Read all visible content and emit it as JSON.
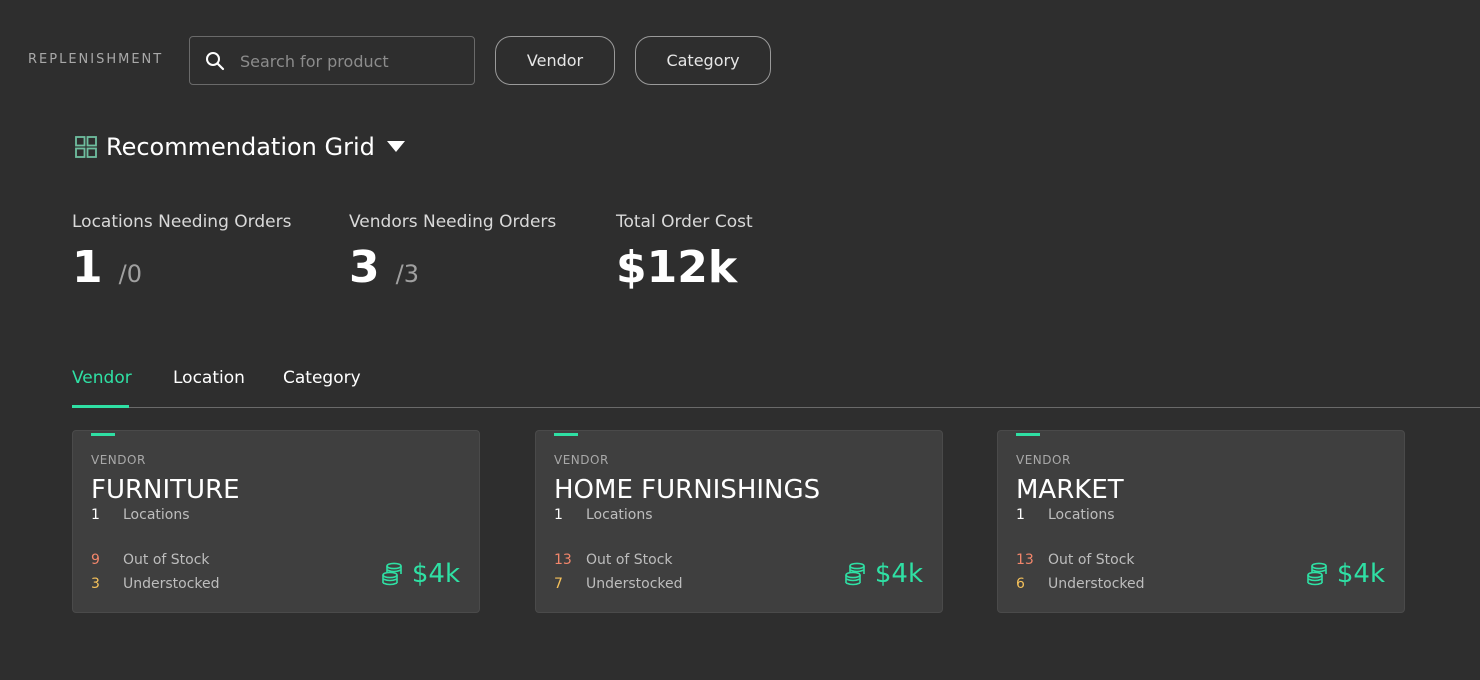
{
  "app": {
    "label": "REPLENISHMENT"
  },
  "search": {
    "placeholder": "Search for product",
    "value": ""
  },
  "filters": {
    "vendor_label": "Vendor",
    "category_label": "Category"
  },
  "view": {
    "title": "Recommendation Grid"
  },
  "metrics": [
    {
      "label": "Locations Needing Orders",
      "value": "1",
      "total": "/0"
    },
    {
      "label": "Vendors Needing Orders",
      "value": "3",
      "total": "/3"
    },
    {
      "label": "Total Order Cost",
      "value": "$12k"
    }
  ],
  "tabs": [
    {
      "label": "Vendor",
      "active": true
    },
    {
      "label": "Location",
      "active": false
    },
    {
      "label": "Category",
      "active": false
    }
  ],
  "cards": [
    {
      "kicker": "VENDOR",
      "name": "FURNITURE",
      "locations": "1",
      "locations_label": "Locations",
      "out_of_stock": "9",
      "out_of_stock_label": "Out of Stock",
      "understocked": "3",
      "understocked_label": "Understocked",
      "cost": "$4k"
    },
    {
      "kicker": "VENDOR",
      "name": "HOME FURNISHINGS",
      "locations": "1",
      "locations_label": "Locations",
      "out_of_stock": "13",
      "out_of_stock_label": "Out of Stock",
      "understocked": "7",
      "understocked_label": "Understocked",
      "cost": "$4k"
    },
    {
      "kicker": "VENDOR",
      "name": "MARKET",
      "locations": "1",
      "locations_label": "Locations",
      "out_of_stock": "13",
      "out_of_stock_label": "Out of Stock",
      "understocked": "6",
      "understocked_label": "Understocked",
      "cost": "$4k"
    }
  ],
  "icons": {
    "search": "search-icon",
    "grid": "grid-icon",
    "caret": "caret-down-icon",
    "coins": "coins-icon"
  },
  "colors": {
    "background": "#2e2e2e",
    "card": "#3f3f3f",
    "accent": "#2fe0a4",
    "out_of_stock": "#f2866b",
    "understocked": "#f5c15a"
  }
}
